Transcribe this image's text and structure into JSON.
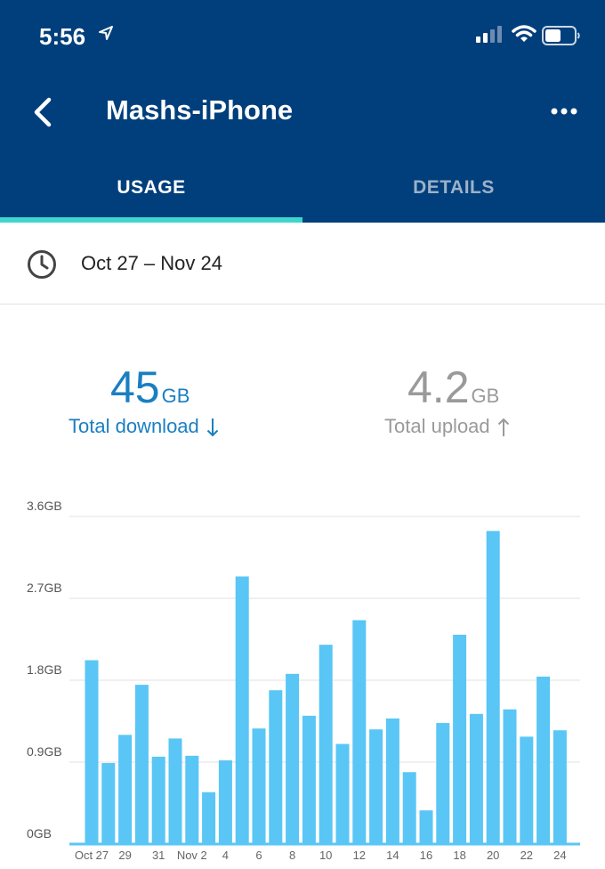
{
  "status_bar": {
    "time": "5:56"
  },
  "header": {
    "title": "Mashs-iPhone"
  },
  "tabs": [
    {
      "label": "USAGE",
      "active": true
    },
    {
      "label": "DETAILS",
      "active": false
    }
  ],
  "date_range": "Oct 27 – Nov 24",
  "totals": {
    "download": {
      "value": "45",
      "unit": "GB",
      "label": "Total download"
    },
    "upload": {
      "value": "4.2",
      "unit": "GB",
      "label": "Total upload"
    }
  },
  "colors": {
    "header": "#003f7c",
    "tab_indicator": "#3cd6cf",
    "bar": "#59c6f6",
    "download": "#1a7fc1",
    "upload": "#9a9a9a"
  },
  "chart_data": {
    "type": "bar",
    "title": "",
    "xlabel": "",
    "ylabel": "",
    "ylim": [
      0,
      3.6
    ],
    "y_ticks": [
      {
        "value": 0,
        "label": "0GB"
      },
      {
        "value": 0.9,
        "label": "0.9GB"
      },
      {
        "value": 1.8,
        "label": "1.8GB"
      },
      {
        "value": 2.7,
        "label": "2.7GB"
      },
      {
        "value": 3.6,
        "label": "3.6GB"
      }
    ],
    "categories": [
      "Oct 27",
      "Oct 28",
      "29",
      "Oct 30",
      "31",
      "Nov 1",
      "Nov 2",
      "Nov 3",
      "4",
      "Nov 5",
      "6",
      "Nov 7",
      "8",
      "Nov 9",
      "10",
      "Nov 11",
      "12",
      "Nov 13",
      "14",
      "Nov 15",
      "16",
      "Nov 17",
      "18",
      "Nov 19",
      "20",
      "Nov 21",
      "22",
      "Nov 23",
      "24"
    ],
    "x_tick_labels": [
      "Oct 27",
      "",
      "29",
      "",
      "31",
      "",
      "Nov 2",
      "",
      "4",
      "",
      "6",
      "",
      "8",
      "",
      "10",
      "",
      "12",
      "",
      "14",
      "",
      "16",
      "",
      "18",
      "",
      "20",
      "",
      "22",
      "",
      "24"
    ],
    "values": [
      2.02,
      0.89,
      1.2,
      1.75,
      0.96,
      1.16,
      0.97,
      0.57,
      0.92,
      2.94,
      1.27,
      1.69,
      1.87,
      1.41,
      2.19,
      1.1,
      2.46,
      1.26,
      1.38,
      0.79,
      0.37,
      1.33,
      2.3,
      1.43,
      3.44,
      1.48,
      1.18,
      1.84,
      1.25
    ],
    "grid": true,
    "series_color": "#59c6f6"
  }
}
